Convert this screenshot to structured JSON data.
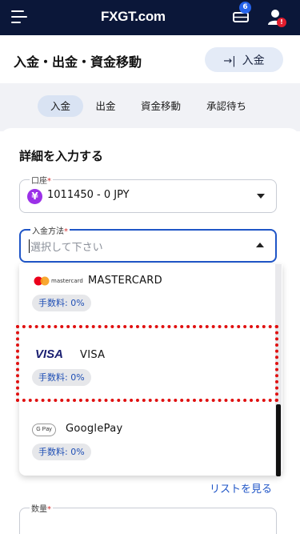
{
  "topbar": {
    "logo_fx": "FX",
    "logo_gt": "GT",
    "logo_com": ".com",
    "notification_count": "6",
    "alert_mark": "!"
  },
  "header": {
    "title": "入金・出金・資金移動",
    "deposit_button": "入金"
  },
  "tabs": [
    {
      "label": "入金",
      "active": true
    },
    {
      "label": "出金",
      "active": false
    },
    {
      "label": "資金移動",
      "active": false
    },
    {
      "label": "承認待ち",
      "active": false
    }
  ],
  "form": {
    "section_title": "詳細を入力する",
    "account": {
      "label": "口座",
      "required_mark": "*",
      "currency_symbol": "¥",
      "value": "1011450 - 0 JPY"
    },
    "method": {
      "label": "入金方法",
      "required_mark": "*",
      "placeholder": "選択して下さい"
    },
    "methods": [
      {
        "name": "MASTERCARD",
        "logo_text": "mastercard",
        "fee": "手数料: 0%"
      },
      {
        "name": "VISA",
        "logo_text": "VISA",
        "fee": "手数料: 0%",
        "highlighted": true
      },
      {
        "name": "GooglePay",
        "logo_text": "G Pay",
        "fee": "手数料: 0%"
      }
    ],
    "list_link": "リストを見る",
    "quantity": {
      "label": "数量",
      "required_mark": "*"
    }
  },
  "colors": {
    "topbar_bg": "#0b1739",
    "accent_blue": "#1f55c7",
    "highlight_red": "#e01010",
    "account_icon": "#9b30e8"
  }
}
